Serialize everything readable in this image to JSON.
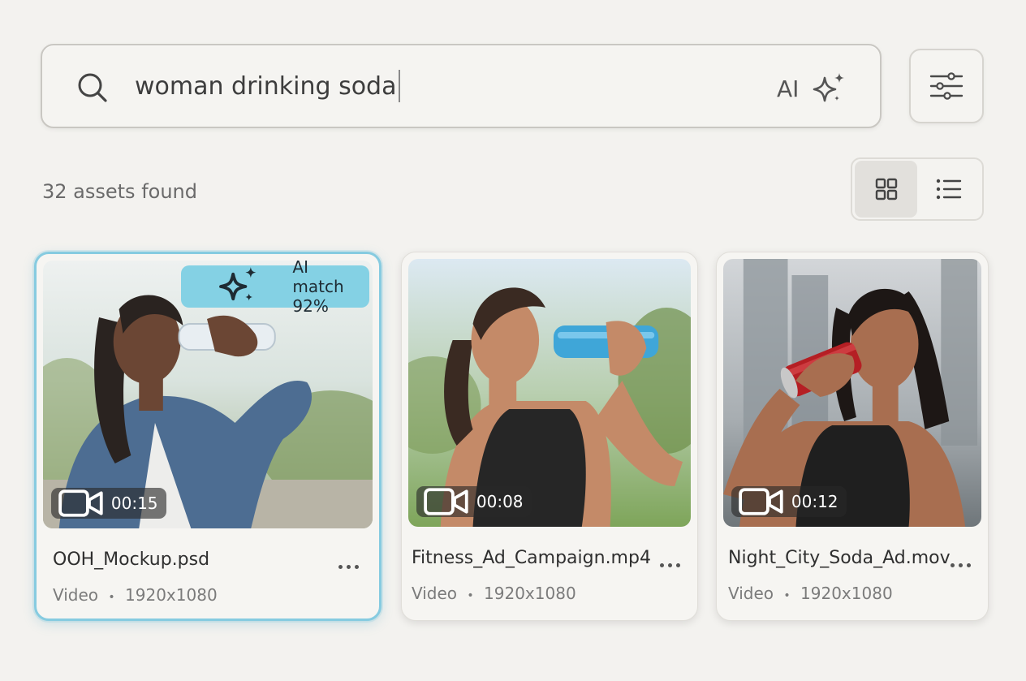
{
  "search": {
    "query": "woman drinking soda",
    "ai_label": "AI",
    "icon": "search-icon",
    "ai_icon": "sparkle-icon"
  },
  "filter_icon": "sliders-icon",
  "results": {
    "count_text": "32 assets found"
  },
  "view_toggle": {
    "grid_icon": "grid-icon",
    "list_icon": "list-icon",
    "active": "grid"
  },
  "colors": {
    "accent": "#84d1e4",
    "selected_border": "#86cbe0",
    "background": "#f3f2ef"
  },
  "cards": [
    {
      "file_name": "OOH_Mockup.psd",
      "type": "Video",
      "resolution": "1920x1080",
      "separator": "•",
      "duration": "00:15",
      "selected": true,
      "ai_match": "AI match 92%"
    },
    {
      "file_name": "Fitness_Ad_Campaign.mp4",
      "type": "Video",
      "resolution": "1920x1080",
      "separator": "•",
      "duration": "00:08",
      "selected": false
    },
    {
      "file_name": "Night_City_Soda_Ad.mov",
      "type": "Video",
      "resolution": "1920x1080",
      "separator": "•",
      "duration": "00:12",
      "selected": false
    }
  ]
}
